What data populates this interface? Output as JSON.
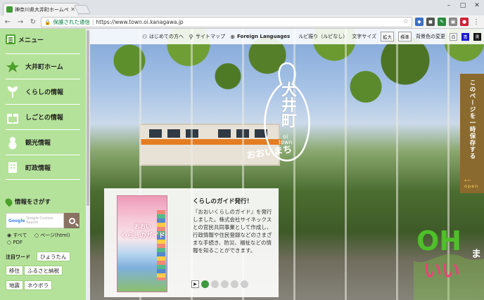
{
  "browser": {
    "tab_title": "神奈川県大井町ホームペー",
    "secure_label": "保護された通信",
    "url": "https://www.town.oi.kanagawa.jp"
  },
  "sidebar": {
    "menu_label": "メニュー",
    "items": [
      {
        "label": "大井町ホーム",
        "icon": "town-emblem-icon"
      },
      {
        "label": "くらしの情報",
        "icon": "sprout-icon"
      },
      {
        "label": "しごとの情報",
        "icon": "gift-icon"
      },
      {
        "label": "観光情報",
        "icon": "gourd-icon"
      },
      {
        "label": "町政情報",
        "icon": "building-icon"
      }
    ],
    "search_title": "情報をさがす",
    "search_placeholder": "Google Custom Search",
    "radio_options": [
      "すべて",
      "ページ(html)",
      "PDF"
    ],
    "keyword_label": "注目ワード",
    "keywords": [
      "ひょうたん",
      "移住",
      "ふるさと納税",
      "地震",
      "ネウボラ"
    ]
  },
  "topnav": {
    "links": [
      "はじめての方へ",
      "サイトマップ",
      "Foreign Languages"
    ],
    "ruby_label": "ルビ振り（ルビなし）",
    "text_size_label": "文字サイズ",
    "enlarge": "拡大",
    "standard": "標準",
    "bg_color_label": "背景色の変更",
    "colors": [
      "白",
      "青",
      "黒"
    ]
  },
  "hero": {
    "logo_title": "大井町",
    "logo_roman_1": "oi",
    "logo_roman_2": "town",
    "logo_sub": "おおいまち",
    "save_tab": "このページを一時保存する",
    "save_tab_open": "open"
  },
  "news_card": {
    "title": "くらしのガイド発行！",
    "body": "『おおいくらしのガイド』を発行しました。株式会社サイネックスとの官民共同事業として作成し、行政情報や住民登録などのさまざまな手続き、防災、福祉などの情報を知ることができます。",
    "book_title_1": "おおい",
    "book_title_2": "くらしのガイド",
    "slides": 5,
    "active_slide": 1
  },
  "oh_badge": {
    "text1": "OH",
    "text2": "いい",
    "text3": "ま"
  },
  "colors": {
    "sidebar_bg": "#b5e29a",
    "accent_green": "#4ca12b",
    "save_tab_bg": "#8a6a2e"
  }
}
